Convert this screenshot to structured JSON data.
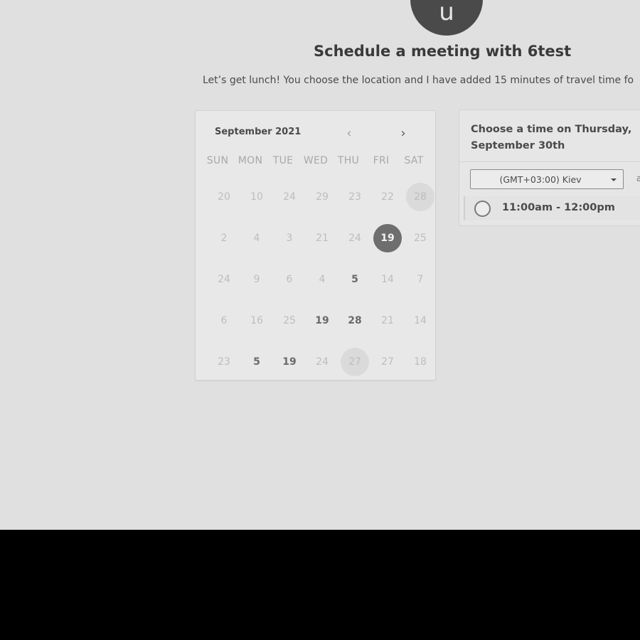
{
  "host": {
    "avatar_letter": "u"
  },
  "page": {
    "title": "Schedule a meeting with 6test",
    "description": "Let’s get lunch! You choose the location and I have added 15 minutes of travel time fo"
  },
  "calendar": {
    "month_label": "September 2021",
    "prev_icon": "‹",
    "next_icon": "›",
    "weekdays": [
      "SUN",
      "MON",
      "TUE",
      "WED",
      "THU",
      "FRI",
      "SAT"
    ],
    "weeks": [
      [
        {
          "label": "20",
          "state": "disabled"
        },
        {
          "label": "10",
          "state": "disabled"
        },
        {
          "label": "24",
          "state": "disabled"
        },
        {
          "label": "29",
          "state": "disabled"
        },
        {
          "label": "23",
          "state": "disabled"
        },
        {
          "label": "22",
          "state": "disabled"
        },
        {
          "label": "28",
          "state": "highlight"
        }
      ],
      [
        {
          "label": "2",
          "state": "disabled"
        },
        {
          "label": "4",
          "state": "disabled"
        },
        {
          "label": "3",
          "state": "disabled"
        },
        {
          "label": "21",
          "state": "disabled"
        },
        {
          "label": "24",
          "state": "disabled"
        },
        {
          "label": "19",
          "state": "selected"
        },
        {
          "label": "25",
          "state": "disabled"
        }
      ],
      [
        {
          "label": "24",
          "state": "disabled"
        },
        {
          "label": "9",
          "state": "disabled"
        },
        {
          "label": "6",
          "state": "disabled"
        },
        {
          "label": "4",
          "state": "disabled"
        },
        {
          "label": "5",
          "state": "available"
        },
        {
          "label": "14",
          "state": "disabled"
        },
        {
          "label": "7",
          "state": "disabled"
        }
      ],
      [
        {
          "label": "6",
          "state": "disabled"
        },
        {
          "label": "16",
          "state": "disabled"
        },
        {
          "label": "25",
          "state": "disabled"
        },
        {
          "label": "19",
          "state": "available"
        },
        {
          "label": "28",
          "state": "available"
        },
        {
          "label": "21",
          "state": "disabled"
        },
        {
          "label": "14",
          "state": "disabled"
        }
      ],
      [
        {
          "label": "23",
          "state": "disabled"
        },
        {
          "label": "5",
          "state": "available"
        },
        {
          "label": "19",
          "state": "available"
        },
        {
          "label": "24",
          "state": "disabled"
        },
        {
          "label": "27",
          "state": "highlight"
        },
        {
          "label": "27",
          "state": "disabled"
        },
        {
          "label": "18",
          "state": "disabled"
        }
      ]
    ]
  },
  "time_panel": {
    "heading": "Choose a time on Thursday, September 30th",
    "timezone": {
      "selected": "(GMT+03:00) Kiev",
      "caret_icon": "chevron-down-icon",
      "extra_text": "a"
    },
    "slots": [
      {
        "label": "11:00am - 12:00pm",
        "selected": false
      }
    ]
  },
  "colors": {
    "background": "#e0e0e0",
    "bottom_bar": "#000000",
    "selected_day": "#6e6e6e",
    "text_primary": "#3a3a3a"
  }
}
